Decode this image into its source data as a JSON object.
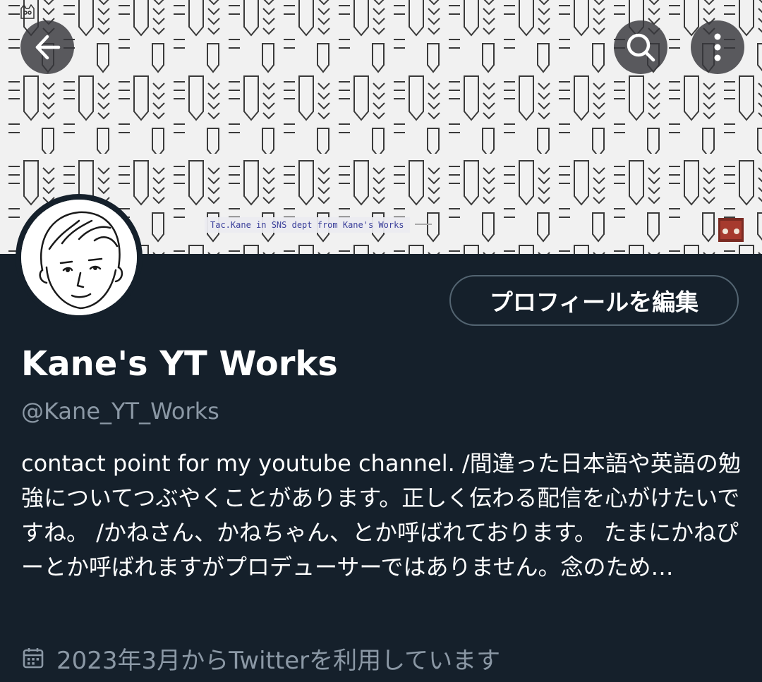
{
  "header": {
    "banner_caption": "Tac.Kane in SNS dept from Kane's Works",
    "back_icon": "arrow-left-icon",
    "search_icon": "search-icon",
    "more_icon": "more-vertical-icon"
  },
  "profile": {
    "edit_button_label": "プロフィールを編集",
    "display_name": "Kane's YT Works",
    "handle": "@Kane_YT_Works",
    "bio": "contact point for my youtube channel.  /間違った日本語や英語の勉強についてつぶやくことがあります。正しく伝わる配信を心がけたいですね。 /かねさん、かねちゃん、とか呼ばれております。 たまにかねぴーとか呼ばれますがプロデューサーではありません。念のため…",
    "joined_text": "2023年3月からTwitterを利用しています",
    "joined_icon": "calendar-icon"
  },
  "colors": {
    "background": "#15202b",
    "muted_text": "#8b98a5",
    "button_border": "#536471",
    "banner_bg": "#f1f1f1"
  }
}
